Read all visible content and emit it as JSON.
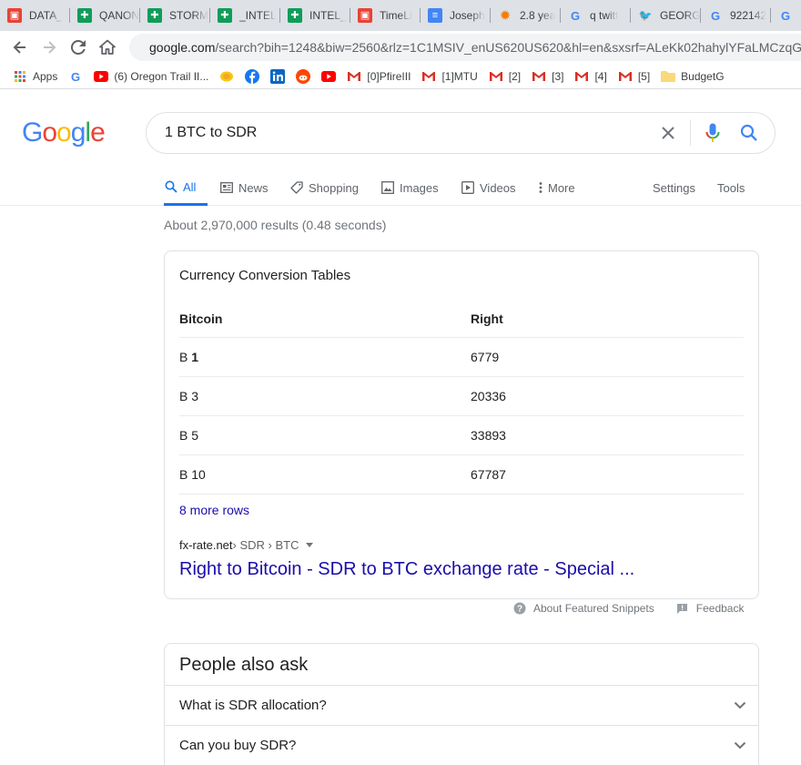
{
  "browser": {
    "tabs": [
      {
        "label": "DATA_",
        "icon": "slides-icon",
        "color": "#e94235",
        "glyph": "▣"
      },
      {
        "label": "QANON",
        "icon": "sheets-icon",
        "color": "#0f9d58",
        "glyph": "✚"
      },
      {
        "label": "STORM",
        "icon": "sheets-icon",
        "color": "#0f9d58",
        "glyph": "✚"
      },
      {
        "label": "_INTEL",
        "icon": "sheets-icon",
        "color": "#0f9d58",
        "glyph": "✚"
      },
      {
        "label": "INTEL_",
        "icon": "sheets-icon",
        "color": "#0f9d58",
        "glyph": "✚"
      },
      {
        "label": "TimeLi",
        "icon": "slides-icon",
        "color": "#e94235",
        "glyph": "▣"
      },
      {
        "label": "Joseph",
        "icon": "docs-icon",
        "color": "#4285f4",
        "glyph": "≡"
      },
      {
        "label": "2.8 yea",
        "icon": "gear-icon",
        "color": "#f57c00",
        "glyph": "✹"
      },
      {
        "label": "q twitt",
        "icon": "google-icon",
        "color": "#ffffff",
        "glyph": "G"
      },
      {
        "label": "GEORG",
        "icon": "twitter-icon",
        "color": "#ffffff",
        "glyph": "🐦"
      },
      {
        "label": "922142",
        "icon": "google-icon",
        "color": "#ffffff",
        "glyph": "G"
      },
      {
        "label": "I",
        "icon": "google-icon",
        "color": "#ffffff",
        "glyph": "G"
      }
    ],
    "url_host": "google.com",
    "url_rest": "/search?bih=1248&biw=2560&rlz=1C1MSIV_enUS620US620&hl=en&sxsrf=ALeKk02hahylYFaLMCzqG",
    "bookmarks": [
      {
        "label": "Apps",
        "icon": "apps-grid-icon"
      },
      {
        "label": "",
        "icon": "google-icon"
      },
      {
        "label": "(6) Oregon Trail II...",
        "icon": "youtube-icon"
      },
      {
        "label": "",
        "icon": "coin-icon"
      },
      {
        "label": "",
        "icon": "facebook-icon"
      },
      {
        "label": "",
        "icon": "linkedin-icon"
      },
      {
        "label": "",
        "icon": "reddit-icon"
      },
      {
        "label": "",
        "icon": "youtube-icon"
      },
      {
        "label": "[0]PfireIII",
        "icon": "gmail-icon"
      },
      {
        "label": "[1]MTU",
        "icon": "gmail-icon"
      },
      {
        "label": "[2]",
        "icon": "gmail-icon"
      },
      {
        "label": "[3]",
        "icon": "gmail-icon"
      },
      {
        "label": "[4]",
        "icon": "gmail-icon"
      },
      {
        "label": "[5]",
        "icon": "gmail-icon"
      },
      {
        "label": "BudgetG",
        "icon": "folder-icon"
      }
    ]
  },
  "search": {
    "query": "1 BTC to SDR",
    "logo_letters": [
      {
        "ch": "G",
        "color": "#4285f4"
      },
      {
        "ch": "o",
        "color": "#ea4335"
      },
      {
        "ch": "o",
        "color": "#fbbc05"
      },
      {
        "ch": "g",
        "color": "#4285f4"
      },
      {
        "ch": "l",
        "color": "#34a853"
      },
      {
        "ch": "e",
        "color": "#ea4335"
      }
    ],
    "nav": {
      "all": "All",
      "news": "News",
      "shopping": "Shopping",
      "images": "Images",
      "videos": "Videos",
      "more": "More",
      "settings": "Settings",
      "tools": "Tools"
    },
    "stats": "About 2,970,000 results (0.48 seconds)"
  },
  "snippet": {
    "title": "Currency Conversion Tables",
    "header": {
      "col1": "Bitcoin",
      "col2": "Right"
    },
    "rows": [
      {
        "prefix": "B ",
        "amount": "1",
        "value": "6779",
        "bold_amount": true
      },
      {
        "prefix": "B ",
        "amount": "3",
        "value": "20336",
        "bold_amount": false
      },
      {
        "prefix": "B ",
        "amount": "5",
        "value": "33893",
        "bold_amount": false
      },
      {
        "prefix": "B ",
        "amount": "10",
        "value": "67787",
        "bold_amount": false
      }
    ],
    "more_rows": "8 more rows",
    "source_host": "fx-rate.net",
    "source_crumb": " › SDR › BTC",
    "link_title": "Right to Bitcoin - SDR to BTC exchange rate - Special ...",
    "about_label": "About Featured Snippets",
    "feedback_label": "Feedback"
  },
  "people_also_ask": {
    "title": "People also ask",
    "questions": [
      "What is SDR allocation?",
      "Can you buy SDR?"
    ]
  }
}
